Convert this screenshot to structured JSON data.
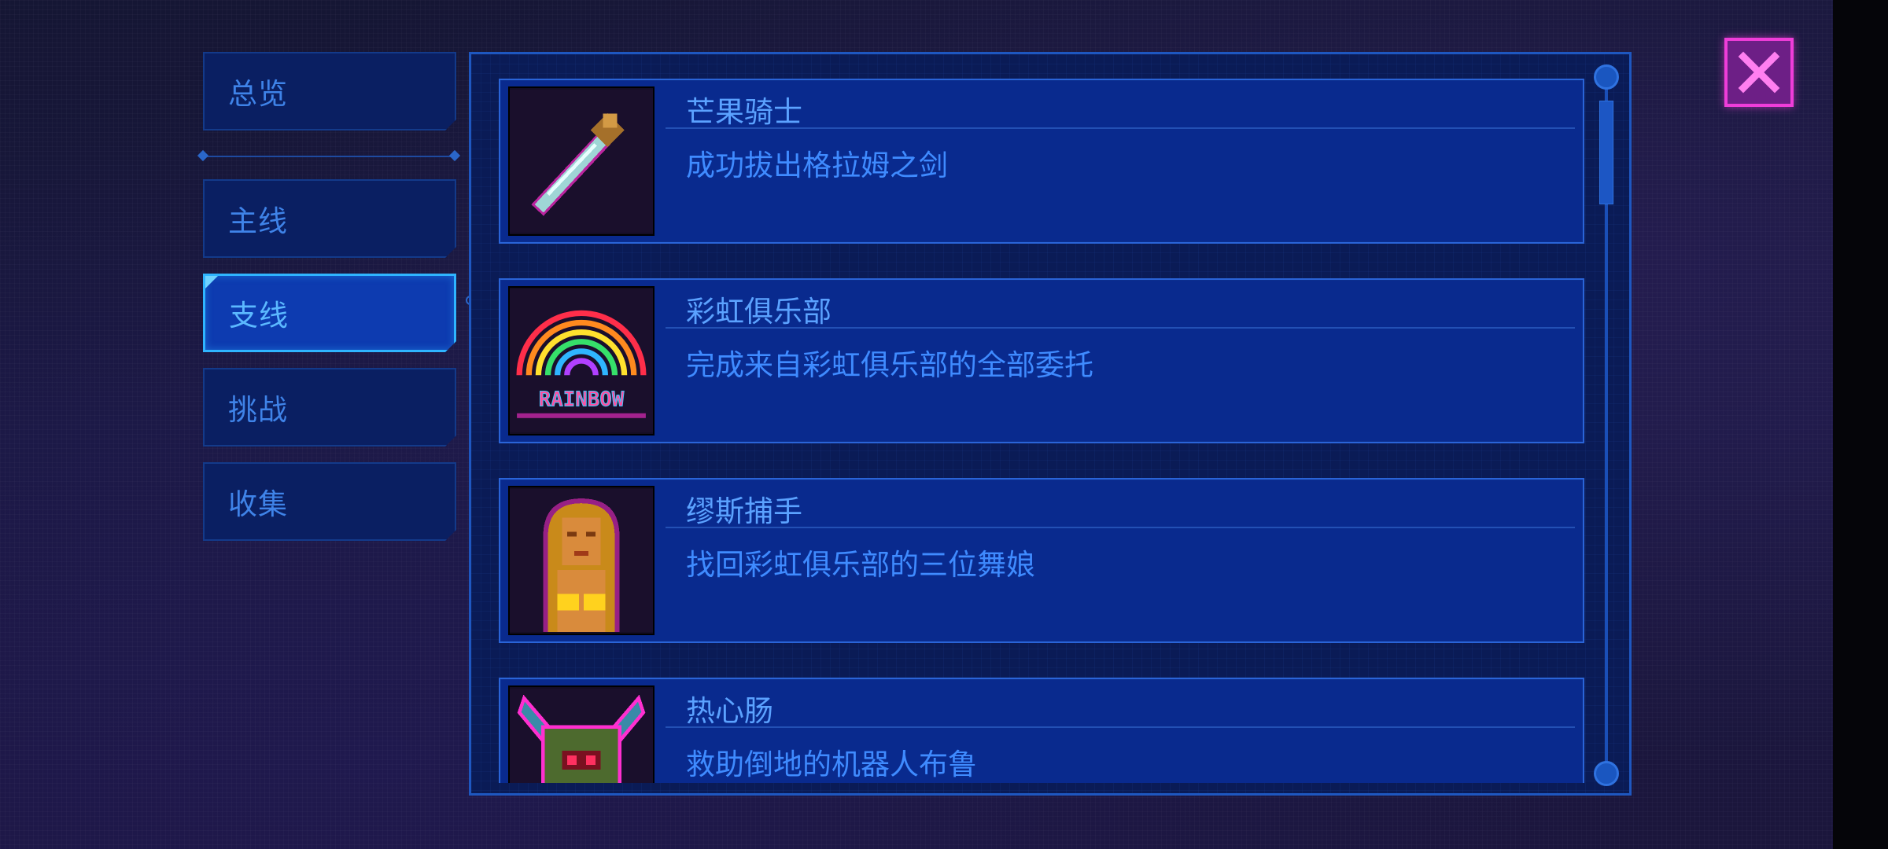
{
  "sidebar": {
    "tabs": [
      {
        "label": "总览",
        "active": false
      },
      {
        "label": "主线",
        "active": false
      },
      {
        "label": "支线",
        "active": true
      },
      {
        "label": "挑战",
        "active": false
      },
      {
        "label": "收集",
        "active": false
      }
    ]
  },
  "achievements": [
    {
      "title": "芒果骑士",
      "description": "成功拔出格拉姆之剑",
      "icon": "sword-icon"
    },
    {
      "title": "彩虹俱乐部",
      "description": "完成来自彩虹俱乐部的全部委托",
      "icon": "rainbow-club-icon",
      "icon_text": "RAINBOW"
    },
    {
      "title": "缪斯捕手",
      "description": "找回彩虹俱乐部的三位舞娘",
      "icon": "dancer-icon"
    },
    {
      "title": "热心肠",
      "description": "救助倒地的机器人布鲁",
      "icon": "robot-icon"
    }
  ],
  "colors": {
    "accent": "#2fb5ff",
    "panel": "#0a1b56",
    "card": "#092a8e",
    "close": "#ef3dd9"
  },
  "close_button": {
    "icon": "close-icon"
  }
}
